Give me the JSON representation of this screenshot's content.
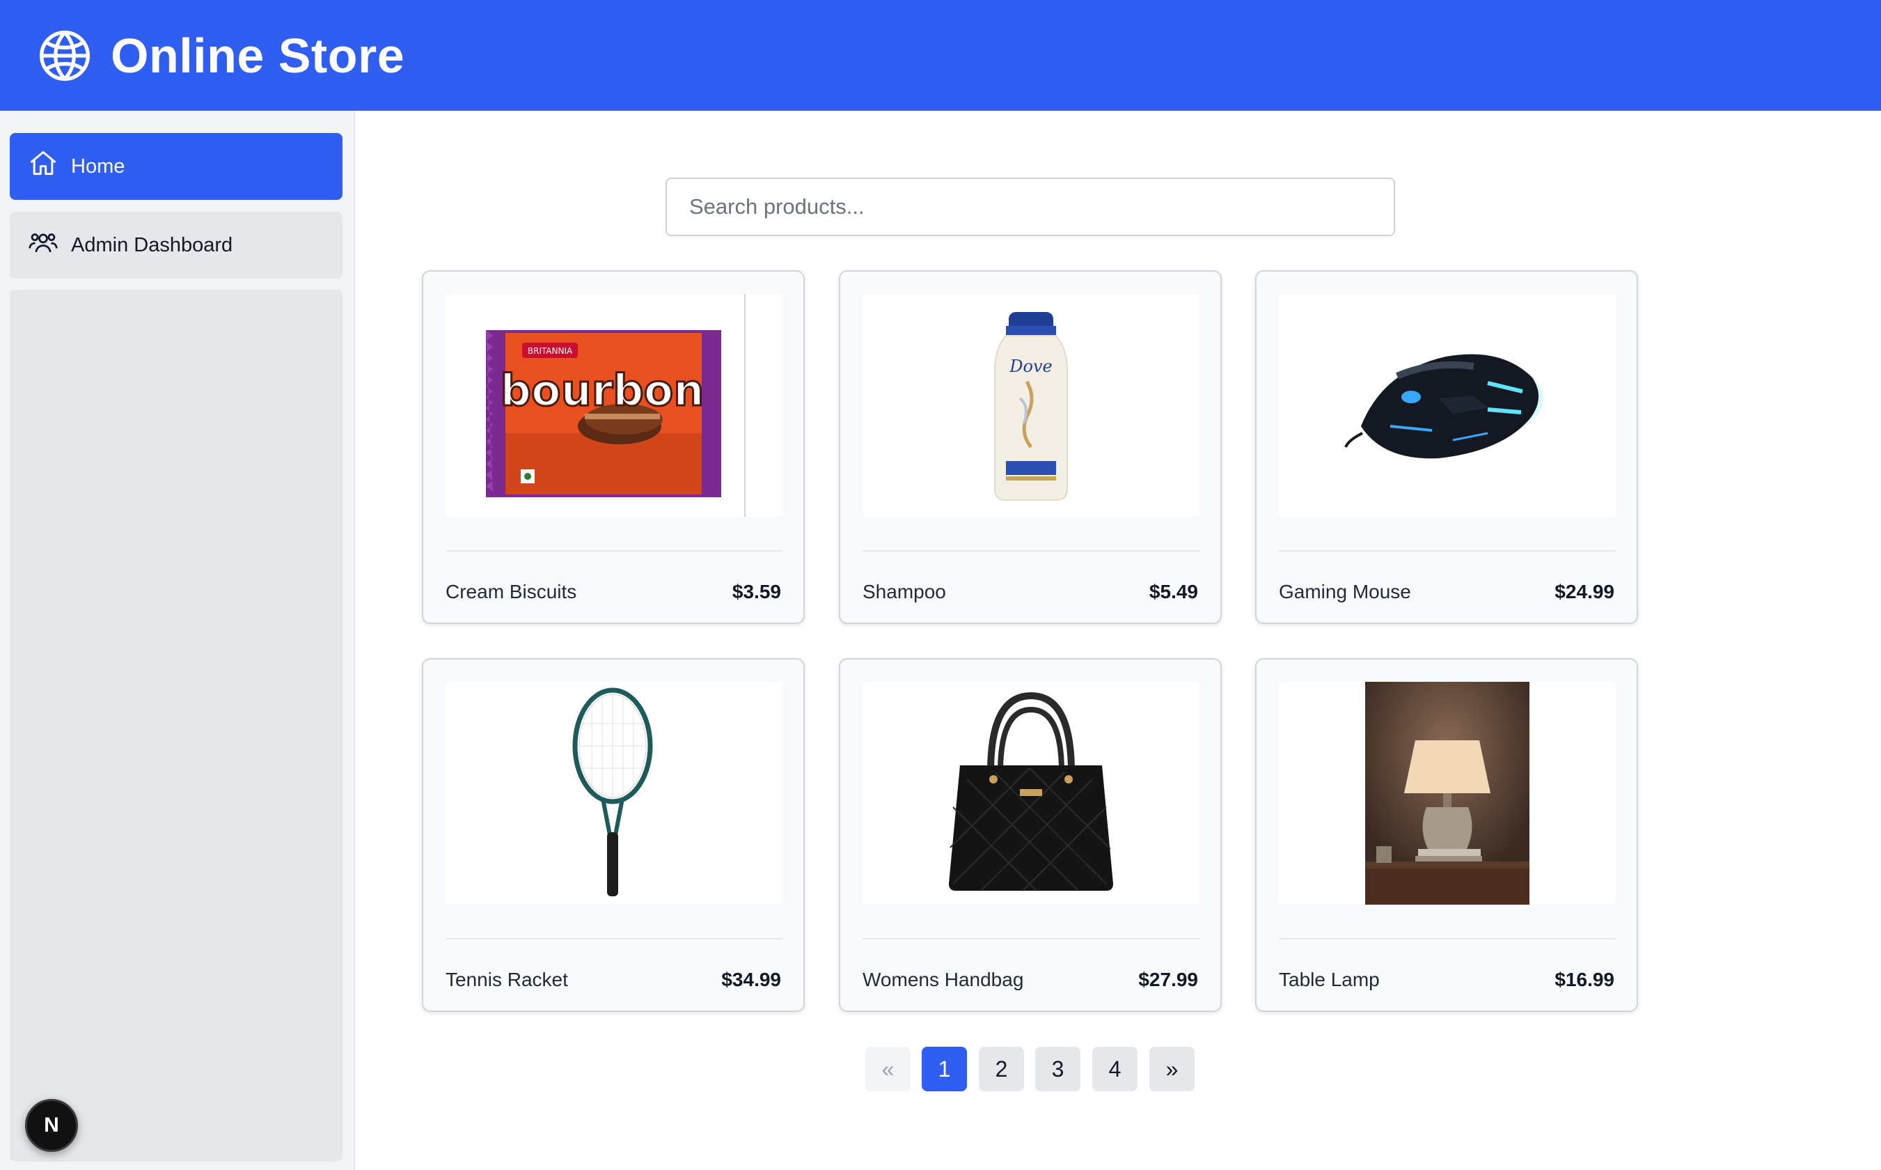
{
  "header": {
    "title": "Online Store",
    "icon": "globe-icon",
    "background": "#2f5ef0"
  },
  "sidebar": {
    "items": [
      {
        "label": "Home",
        "icon": "home-icon",
        "active": true
      },
      {
        "label": "Admin Dashboard",
        "icon": "users-icon",
        "active": false
      }
    ],
    "badge": "N"
  },
  "search": {
    "placeholder": "Search products...",
    "value": ""
  },
  "products": [
    {
      "name": "Cream Biscuits",
      "price": "$3.59",
      "image": "biscuit-pack-image"
    },
    {
      "name": "Shampoo",
      "price": "$5.49",
      "image": "shampoo-bottle-image"
    },
    {
      "name": "Gaming Mouse",
      "price": "$24.99",
      "image": "gaming-mouse-image"
    },
    {
      "name": "Tennis Racket",
      "price": "$34.99",
      "image": "tennis-racket-image"
    },
    {
      "name": "Womens Handbag",
      "price": "$27.99",
      "image": "handbag-image"
    },
    {
      "name": "Table Lamp",
      "price": "$16.99",
      "image": "table-lamp-image"
    }
  ],
  "product_image_text": {
    "biscuit_brand": "bourbon",
    "biscuit_maker": "BRITANNIA",
    "shampoo_brand": "Dove"
  },
  "pagination": {
    "prev": "«",
    "next": "»",
    "pages": [
      "1",
      "2",
      "3",
      "4"
    ],
    "current": "1"
  }
}
